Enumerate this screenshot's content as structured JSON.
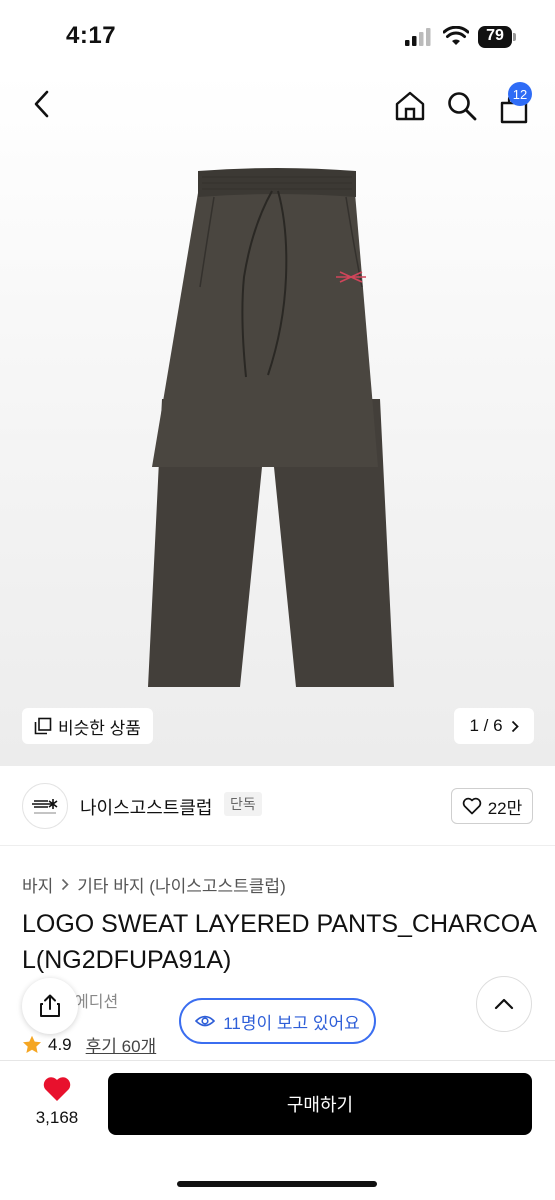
{
  "status_bar": {
    "time": "4:17",
    "battery": "79",
    "icons": [
      "cellular-signal-icon",
      "wifi-icon",
      "battery-icon"
    ]
  },
  "nav": {
    "icons": [
      "back-chevron-icon",
      "home-icon",
      "search-icon",
      "cart-icon"
    ],
    "cart_badge": "12"
  },
  "gallery": {
    "similar_label": "비슷한 상품",
    "page_indicator": "1 / 6",
    "colors": {
      "product_fabric": "#45413c",
      "logo_accent": "#d0455a"
    }
  },
  "brand": {
    "name": "나이스고스트클럽",
    "exclusive_badge": "단독",
    "likes": "22만"
  },
  "product": {
    "breadcrumb": [
      "바지",
      "기타 바지 (나이스고스트클럽)"
    ],
    "title": "LOGO SWEAT LAYERED PANTS_CHARCOAL(NG2DFUPA91A)",
    "tag_partial": "에디션",
    "rating": "4.9",
    "reviews": "후기 60개",
    "viewers": "11명이 보고 있어요"
  },
  "bottom_bar": {
    "wish_count": "3,168",
    "buy_label": "구매하기"
  },
  "colors": {
    "accent_blue": "#2f6cf6",
    "heart_red": "#e8112d",
    "buy_button": "#000000",
    "star": "#f5a623"
  }
}
